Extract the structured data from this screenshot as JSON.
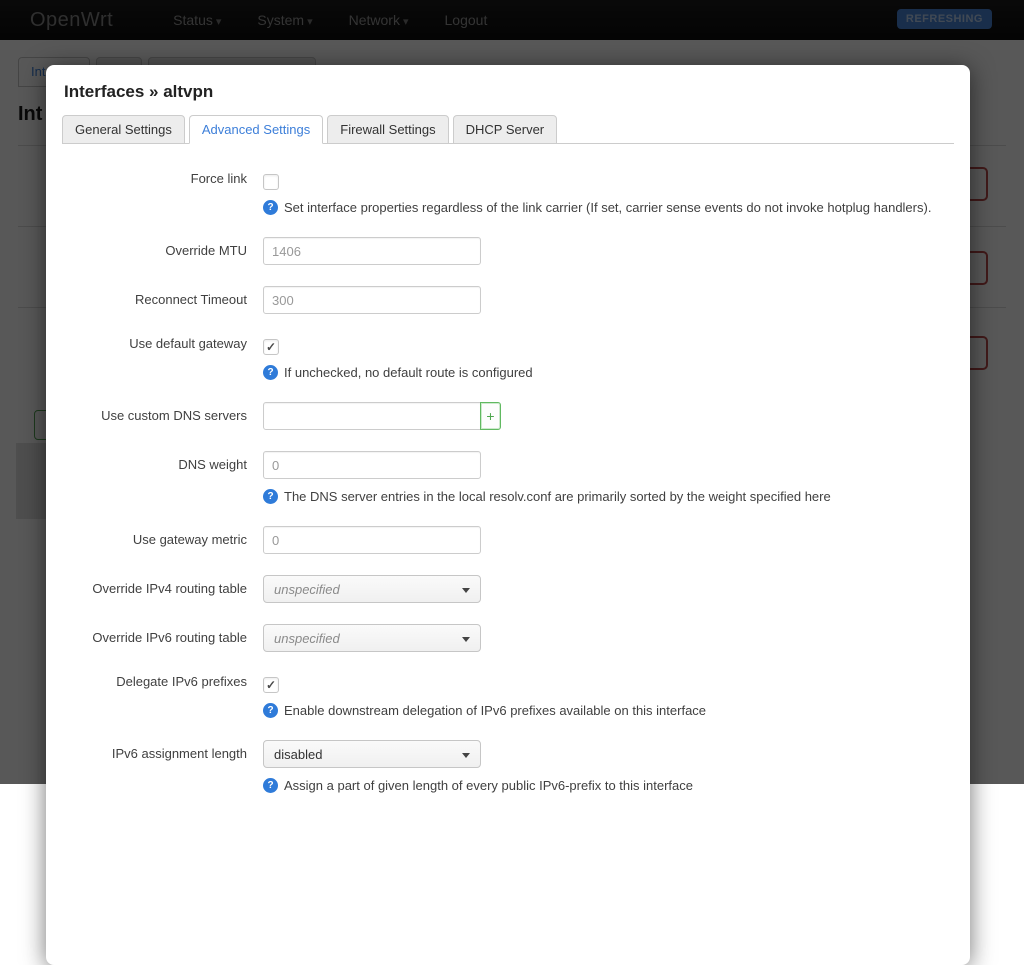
{
  "colors": {
    "accent": "#3d7fd9",
    "help_blue": "#2f7bd9",
    "add_green": "#4ca64c",
    "danger_red": "#b94a48",
    "badge_blue": "#4a86d8"
  },
  "nav": {
    "brand": "OpenWrt",
    "items": [
      {
        "label": "Status",
        "dropdown": true
      },
      {
        "label": "System",
        "dropdown": true
      },
      {
        "label": "Network",
        "dropdown": true
      },
      {
        "label": "Logout",
        "dropdown": false
      }
    ],
    "badge": "REFRESHING"
  },
  "background_page": {
    "active_tab_fragment": "Int",
    "heading_fragment": "Int"
  },
  "modal": {
    "title": "Interfaces » altvpn",
    "tabs": [
      {
        "label": "General Settings",
        "active": false
      },
      {
        "label": "Advanced Settings",
        "active": true
      },
      {
        "label": "Firewall Settings",
        "active": false
      },
      {
        "label": "DHCP Server",
        "active": false
      }
    ],
    "fields": [
      {
        "label": "Force link",
        "type": "checkbox",
        "checked": false,
        "help": "Set interface properties regardless of the link carrier (If set, carrier sense events do not invoke hotplug handlers)."
      },
      {
        "label": "Override MTU",
        "type": "text",
        "value": "",
        "placeholder": "1406"
      },
      {
        "label": "Reconnect Timeout",
        "type": "text",
        "value": "",
        "placeholder": "300"
      },
      {
        "label": "Use default gateway",
        "type": "checkbox",
        "checked": true,
        "help": "If unchecked, no default route is configured"
      },
      {
        "label": "Use custom DNS servers",
        "type": "text-add",
        "value": "",
        "placeholder": "",
        "add_label": "+"
      },
      {
        "label": "DNS weight",
        "type": "text",
        "value": "",
        "placeholder": "0",
        "help": "The DNS server entries in the local resolv.conf are primarily sorted by the weight specified here"
      },
      {
        "label": "Use gateway metric",
        "type": "text",
        "value": "",
        "placeholder": "0"
      },
      {
        "label": "Override IPv4 routing table",
        "type": "select",
        "value": "unspecified",
        "unspecified": true
      },
      {
        "label": "Override IPv6 routing table",
        "type": "select",
        "value": "unspecified",
        "unspecified": true
      },
      {
        "label": "Delegate IPv6 prefixes",
        "type": "checkbox",
        "checked": true,
        "help": "Enable downstream delegation of IPv6 prefixes available on this interface"
      },
      {
        "label": "IPv6 assignment length",
        "type": "select",
        "value": "disabled",
        "unspecified": false,
        "help": "Assign a part of given length of every public IPv6-prefix to this interface"
      }
    ]
  }
}
